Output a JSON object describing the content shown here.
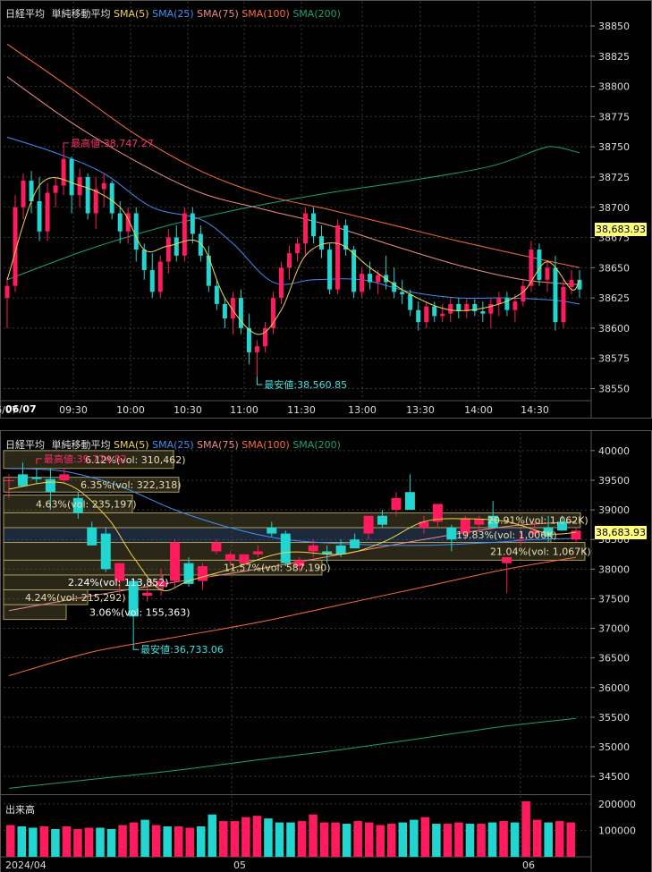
{
  "colors": {
    "background": "#000000",
    "grid": "#3a3a3a",
    "axis_text": "#dcdcdc",
    "up": "#ff1b5e",
    "down": "#22d5d0",
    "sma5": "#f4d44a",
    "sma25": "#3f8ff5",
    "sma75": "#f08a8a",
    "sma100": "#ff6a3a",
    "sma200": "#1aa07a",
    "high_label": "#ff2d6a",
    "low_label": "#3fe0e0",
    "price_tag_bg": "#ffff7a",
    "volume_bar": "#22d5d0",
    "volume_bar_up": "#ff1b5e"
  },
  "legend": {
    "name": "日経平均",
    "type": "単純移動平均",
    "sma5": "SMA(5)",
    "sma25": "SMA(25)",
    "sma75": "SMA(75)",
    "sma100": "SMA(100)",
    "sma200": "SMA(200)"
  },
  "intraday": {
    "high_label": "最高値:38,747.27",
    "low_label": "最安値:38,560.85",
    "last_price": "38,683.93",
    "date_label": "06/07"
  },
  "daily": {
    "high_label": "最高値:39,774.82",
    "low_label": "最安値:36,733.06",
    "last_price": "38,683.93",
    "profile_labels": [
      "6.12%(vol: 310,462)",
      "6.35%(vol: 322,318)",
      "4.63%(vol: 235,197)",
      "20.91%(vol: 1,062K)",
      "19.83%(vol: 1,006K)",
      "21.04%(vol: 1,067K)",
      "11.57%(vol: 587,190)",
      "2.24%(vol: 113,852)",
      "4.24%(vol: 215,292)",
      "3.06%(vol: 155,363)"
    ]
  },
  "volume": {
    "label": "出来高"
  },
  "chart_data": [
    {
      "type": "candlestick",
      "title": "日経平均 単純移動平均 SMA(5) SMA(25) SMA(75) SMA(100) SMA(200)",
      "ylim": [
        38540,
        38870
      ],
      "y_ticks": [
        38550,
        38575,
        38600,
        38625,
        38650,
        38675,
        38700,
        38725,
        38750,
        38775,
        38800,
        38825,
        38850
      ],
      "x_ticks": [
        "06/07",
        "09:30",
        "10:00",
        "10:30",
        "11:00",
        "11:30",
        "13:00",
        "13:30",
        "14:00",
        "14:30"
      ],
      "candles": [
        [
          38625,
          38642,
          38600,
          38635
        ],
        [
          38635,
          38710,
          38630,
          38700
        ],
        [
          38700,
          38728,
          38690,
          38722
        ],
        [
          38722,
          38730,
          38695,
          38705
        ],
        [
          38705,
          38725,
          38672,
          38680
        ],
        [
          38680,
          38720,
          38672,
          38712
        ],
        [
          38712,
          38725,
          38700,
          38718
        ],
        [
          38718,
          38748,
          38710,
          38740
        ],
        [
          38740,
          38742,
          38695,
          38710
        ],
        [
          38710,
          38732,
          38700,
          38725
        ],
        [
          38725,
          38728,
          38690,
          38695
        ],
        [
          38695,
          38725,
          38682,
          38715
        ],
        [
          38715,
          38728,
          38700,
          38720
        ],
        [
          38720,
          38722,
          38690,
          38695
        ],
        [
          38695,
          38705,
          38670,
          38680
        ],
        [
          38680,
          38700,
          38670,
          38695
        ],
        [
          38695,
          38700,
          38655,
          38665
        ],
        [
          38665,
          38670,
          38640,
          38648
        ],
        [
          38648,
          38662,
          38625,
          38630
        ],
        [
          38630,
          38660,
          38625,
          38655
        ],
        [
          38655,
          38682,
          38645,
          38675
        ],
        [
          38675,
          38685,
          38655,
          38660
        ],
        [
          38660,
          38700,
          38655,
          38695
        ],
        [
          38695,
          38700,
          38670,
          38678
        ],
        [
          38678,
          38685,
          38655,
          38660
        ],
        [
          38660,
          38668,
          38630,
          38635
        ],
        [
          38635,
          38640,
          38615,
          38620
        ],
        [
          38620,
          38625,
          38600,
          38608
        ],
        [
          38608,
          38630,
          38595,
          38625
        ],
        [
          38625,
          38632,
          38595,
          38600
        ],
        [
          38600,
          38612,
          38570,
          38580
        ],
        [
          38580,
          38590,
          38560,
          38585
        ],
        [
          38585,
          38605,
          38580,
          38600
        ],
        [
          38600,
          38630,
          38595,
          38625
        ],
        [
          38625,
          38655,
          38620,
          38650
        ],
        [
          38650,
          38668,
          38640,
          38662
        ],
        [
          38662,
          38675,
          38655,
          38670
        ],
        [
          38670,
          38700,
          38660,
          38695
        ],
        [
          38695,
          38700,
          38670,
          38676
        ],
        [
          38676,
          38685,
          38658,
          38665
        ],
        [
          38665,
          38670,
          38628,
          38632
        ],
        [
          38632,
          38690,
          38628,
          38685
        ],
        [
          38685,
          38690,
          38660,
          38665
        ],
        [
          38665,
          38668,
          38625,
          38630
        ],
        [
          38630,
          38650,
          38625,
          38645
        ],
        [
          38645,
          38655,
          38632,
          38638
        ],
        [
          38638,
          38648,
          38628,
          38644
        ],
        [
          38644,
          38660,
          38632,
          38638
        ],
        [
          38638,
          38650,
          38625,
          38630
        ],
        [
          38630,
          38640,
          38620,
          38628
        ],
        [
          38628,
          38632,
          38610,
          38615
        ],
        [
          38615,
          38622,
          38598,
          38605
        ],
        [
          38605,
          38622,
          38600,
          38618
        ],
        [
          38618,
          38622,
          38605,
          38610
        ],
        [
          38610,
          38620,
          38605,
          38612
        ],
        [
          38612,
          38625,
          38605,
          38620
        ],
        [
          38620,
          38625,
          38608,
          38614
        ],
        [
          38614,
          38625,
          38608,
          38620
        ],
        [
          38620,
          38624,
          38610,
          38614
        ],
        [
          38614,
          38622,
          38605,
          38612
        ],
        [
          38612,
          38625,
          38600,
          38620
        ],
        [
          38620,
          38630,
          38610,
          38625
        ],
        [
          38625,
          38630,
          38610,
          38615
        ],
        [
          38615,
          38628,
          38605,
          38622
        ],
        [
          38622,
          38640,
          38618,
          38635
        ],
        [
          38635,
          38672,
          38630,
          38665
        ],
        [
          38665,
          38670,
          38635,
          38640
        ],
        [
          38640,
          38655,
          38630,
          38650
        ],
        [
          38650,
          38660,
          38598,
          38605
        ],
        [
          38605,
          38640,
          38600,
          38634
        ],
        [
          38634,
          38648,
          38628,
          38640
        ],
        [
          38640,
          38648,
          38625,
          38632
        ]
      ],
      "sma5_anchors": [
        [
          0,
          38640
        ],
        [
          4,
          38718
        ],
        [
          9,
          38718
        ],
        [
          14,
          38700
        ],
        [
          17,
          38665
        ],
        [
          20,
          38668
        ],
        [
          24,
          38670
        ],
        [
          27,
          38625
        ],
        [
          31,
          38595
        ],
        [
          34,
          38615
        ],
        [
          37,
          38660
        ],
        [
          41,
          38670
        ],
        [
          45,
          38650
        ],
        [
          50,
          38628
        ],
        [
          55,
          38615
        ],
        [
          60,
          38618
        ],
        [
          64,
          38630
        ],
        [
          67,
          38655
        ],
        [
          70,
          38632
        ],
        [
          71,
          38640
        ]
      ],
      "sma25_anchors": [
        [
          0,
          38758
        ],
        [
          6,
          38745
        ],
        [
          12,
          38728
        ],
        [
          18,
          38700
        ],
        [
          24,
          38690
        ],
        [
          28,
          38670
        ],
        [
          33,
          38638
        ],
        [
          38,
          38640
        ],
        [
          44,
          38640
        ],
        [
          50,
          38630
        ],
        [
          56,
          38625
        ],
        [
          62,
          38625
        ],
        [
          68,
          38623
        ],
        [
          71,
          38620
        ]
      ],
      "sma75_anchors": [
        [
          0,
          38808
        ],
        [
          8,
          38770
        ],
        [
          16,
          38738
        ],
        [
          24,
          38712
        ],
        [
          32,
          38698
        ],
        [
          40,
          38685
        ],
        [
          48,
          38668
        ],
        [
          56,
          38652
        ],
        [
          64,
          38640
        ],
        [
          71,
          38636
        ]
      ],
      "sma100_anchors": [
        [
          0,
          38835
        ],
        [
          8,
          38798
        ],
        [
          16,
          38760
        ],
        [
          24,
          38730
        ],
        [
          32,
          38710
        ],
        [
          40,
          38698
        ],
        [
          48,
          38685
        ],
        [
          56,
          38672
        ],
        [
          64,
          38660
        ],
        [
          71,
          38650
        ]
      ],
      "sma200_anchors": [
        [
          0,
          38640
        ],
        [
          10,
          38665
        ],
        [
          20,
          38685
        ],
        [
          30,
          38700
        ],
        [
          40,
          38712
        ],
        [
          50,
          38722
        ],
        [
          60,
          38734
        ],
        [
          66,
          38748
        ],
        [
          68,
          38750
        ],
        [
          71,
          38745
        ]
      ]
    },
    {
      "type": "candlestick",
      "title": "日経平均 単純移動平均 SMA(5) SMA(25) SMA(75) SMA(100) SMA(200)",
      "ylim": [
        34200,
        40300
      ],
      "y_ticks": [
        34500,
        35000,
        35500,
        36000,
        36500,
        37000,
        37500,
        38000,
        38500,
        39000,
        39500,
        40000
      ],
      "x_ticks": [
        "2024/04",
        "05",
        "06"
      ],
      "candles": [
        [
          39500,
          39600,
          39200,
          39500
        ],
        [
          39600,
          39800,
          39450,
          39400
        ],
        [
          39550,
          39700,
          39450,
          39520
        ],
        [
          39520,
          39700,
          39000,
          39300
        ],
        [
          39500,
          39700,
          39450,
          39600
        ],
        [
          39200,
          39300,
          38850,
          38950
        ],
        [
          38700,
          38800,
          38400,
          38400
        ],
        [
          38600,
          38700,
          37950,
          38000
        ],
        [
          37800,
          38100,
          37600,
          38100
        ],
        [
          37800,
          37850,
          36733,
          37200
        ],
        [
          37550,
          37700,
          37450,
          37600
        ],
        [
          37700,
          38000,
          37550,
          37800
        ],
        [
          37800,
          38500,
          37700,
          38450
        ],
        [
          38100,
          38200,
          37700,
          37750
        ],
        [
          37800,
          38100,
          37650,
          38050
        ],
        [
          38300,
          38500,
          38250,
          38450
        ],
        [
          38150,
          38300,
          38050,
          38250
        ],
        [
          38100,
          38250,
          38050,
          38250
        ],
        [
          38250,
          38400,
          38200,
          38300
        ],
        [
          38700,
          38800,
          38550,
          38600
        ],
        [
          38600,
          38650,
          38050,
          38100
        ],
        [
          38050,
          38200,
          37950,
          38150
        ],
        [
          38300,
          38500,
          38200,
          38400
        ],
        [
          38300,
          38400,
          38100,
          38250
        ],
        [
          38400,
          38500,
          38200,
          38250
        ],
        [
          38500,
          38600,
          38450,
          38350
        ],
        [
          38600,
          38900,
          38500,
          38900
        ],
        [
          38900,
          39000,
          38700,
          38750
        ],
        [
          39000,
          39300,
          38900,
          39200
        ],
        [
          39300,
          39600,
          39200,
          39000
        ],
        [
          38700,
          38900,
          38600,
          38800
        ],
        [
          38800,
          39100,
          38700,
          39100
        ],
        [
          38700,
          38750,
          38300,
          38500
        ],
        [
          38600,
          38900,
          38500,
          38850
        ],
        [
          38750,
          38900,
          38650,
          38850
        ],
        [
          38900,
          39150,
          38800,
          38700
        ],
        [
          38100,
          38200,
          37600,
          38200
        ],
        [
          38500,
          38700,
          38400,
          38500
        ],
        [
          38600,
          38800,
          38550,
          38650
        ],
        [
          38700,
          38900,
          38450,
          38550
        ],
        [
          38800,
          38900,
          38650,
          38650
        ],
        [
          38500,
          38700,
          38450,
          38650
        ]
      ],
      "sma5_anchors": [
        [
          0,
          39350
        ],
        [
          4,
          39450
        ],
        [
          7,
          38900
        ],
        [
          9,
          38200
        ],
        [
          11,
          37650
        ],
        [
          13,
          37800
        ],
        [
          16,
          38000
        ],
        [
          20,
          38280
        ],
        [
          24,
          38250
        ],
        [
          27,
          38450
        ],
        [
          30,
          38800
        ],
        [
          33,
          38850
        ],
        [
          36,
          38800
        ],
        [
          39,
          38600
        ],
        [
          41,
          38620
        ]
      ],
      "sma25_anchors": [
        [
          0,
          39700
        ],
        [
          4,
          39650
        ],
        [
          8,
          39400
        ],
        [
          12,
          39000
        ],
        [
          16,
          38700
        ],
        [
          20,
          38500
        ],
        [
          25,
          38420
        ],
        [
          30,
          38400
        ],
        [
          35,
          38450
        ],
        [
          38,
          38500
        ],
        [
          41,
          38520
        ]
      ],
      "sma75_anchors": [
        [
          0,
          37300
        ],
        [
          6,
          37550
        ],
        [
          12,
          37780
        ],
        [
          18,
          38000
        ],
        [
          24,
          38250
        ],
        [
          30,
          38500
        ],
        [
          36,
          38720
        ],
        [
          41,
          38800
        ]
      ],
      "sma100_anchors": [
        [
          0,
          36200
        ],
        [
          6,
          36600
        ],
        [
          12,
          36850
        ],
        [
          18,
          37100
        ],
        [
          24,
          37400
        ],
        [
          30,
          37700
        ],
        [
          36,
          38000
        ],
        [
          41,
          38200
        ]
      ],
      "sma200_anchors": [
        [
          0,
          34300
        ],
        [
          6,
          34450
        ],
        [
          12,
          34600
        ],
        [
          18,
          34780
        ],
        [
          24,
          34950
        ],
        [
          30,
          35150
        ],
        [
          36,
          35350
        ],
        [
          41,
          35480
        ]
      ]
    },
    {
      "type": "bar",
      "title": "出来高",
      "ylim": [
        0,
        230000
      ],
      "y_ticks": [
        100000,
        200000
      ],
      "values": [
        120000,
        115000,
        110000,
        115000,
        105000,
        115000,
        105000,
        110000,
        110000,
        105000,
        120000,
        130000,
        140000,
        120000,
        115000,
        115000,
        110000,
        115000,
        160000,
        135000,
        135000,
        150000,
        155000,
        145000,
        130000,
        130000,
        135000,
        160000,
        130000,
        130000,
        125000,
        135000,
        130000,
        120000,
        125000,
        130000,
        140000,
        150000,
        125000,
        125000,
        130000,
        125000,
        125000,
        130000,
        135000,
        130000,
        210000,
        140000,
        130000,
        135000,
        130000
      ],
      "up_days": [
        0,
        3,
        5,
        6,
        7,
        10,
        11,
        13,
        15,
        16,
        19,
        20,
        21,
        22,
        26,
        27,
        28,
        29,
        31,
        32,
        33,
        34,
        37,
        39,
        40,
        42,
        44,
        46,
        47,
        49,
        50
      ],
      "x_ticks": [
        "2024/04",
        "05",
        "06"
      ]
    }
  ]
}
